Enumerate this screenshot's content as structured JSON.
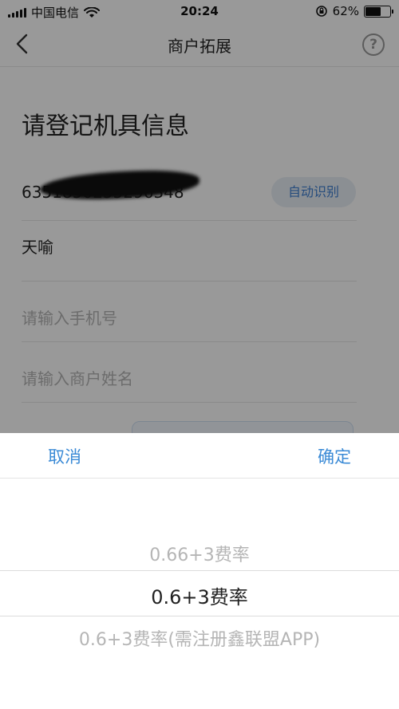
{
  "status_bar": {
    "carrier": "中国电信",
    "time": "20:24",
    "battery_percent": "62%",
    "battery_level": 0.62
  },
  "nav": {
    "title": "商户拓展",
    "help": "?"
  },
  "form": {
    "heading": "请登记机具信息",
    "device_sn": "6351850255296348",
    "auto_detect": "自动识别",
    "device_model": "天喻",
    "phone_placeholder": "请输入手机号",
    "name_placeholder": "请输入商户姓名"
  },
  "picker": {
    "cancel": "取消",
    "confirm": "确定",
    "options": [
      "0.66+3费率",
      "0.6+3费率",
      "0.6+3费率(需注册鑫联盟APP)"
    ],
    "selected_index": 1
  }
}
